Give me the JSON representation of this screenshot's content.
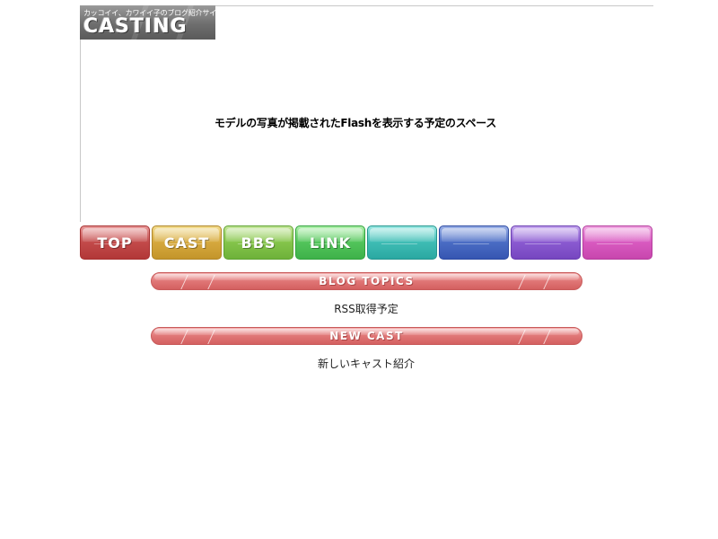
{
  "logo": {
    "tagline": "カッコイイ、カワイイ子のブログ紹介サイト",
    "wordmark": "CASTING"
  },
  "hero": {
    "placeholder_text": "モデルの写真が掲載されたFlashを表示する予定のスペース"
  },
  "nav": {
    "items": [
      {
        "label": "TOP",
        "color": "#c24a4a"
      },
      {
        "label": "CAST",
        "color": "#d5a83e"
      },
      {
        "label": "BBS",
        "color": "#84c44a"
      },
      {
        "label": "LINK",
        "color": "#52c45a"
      },
      {
        "label": "",
        "color": "#3ebcb4"
      },
      {
        "label": "",
        "color": "#4a6cc4"
      },
      {
        "label": "",
        "color": "#8a5ad0"
      },
      {
        "label": "",
        "color": "#d85ac0"
      }
    ]
  },
  "sections": {
    "blog_topics": {
      "title": "BLOG TOPICS",
      "content": "RSS取得予定"
    },
    "new_cast": {
      "title": "NEW CAST",
      "content": "新しいキャスト紹介"
    }
  },
  "colors": {
    "section_bar": "#e07676",
    "rule": "#c8c8c8"
  }
}
